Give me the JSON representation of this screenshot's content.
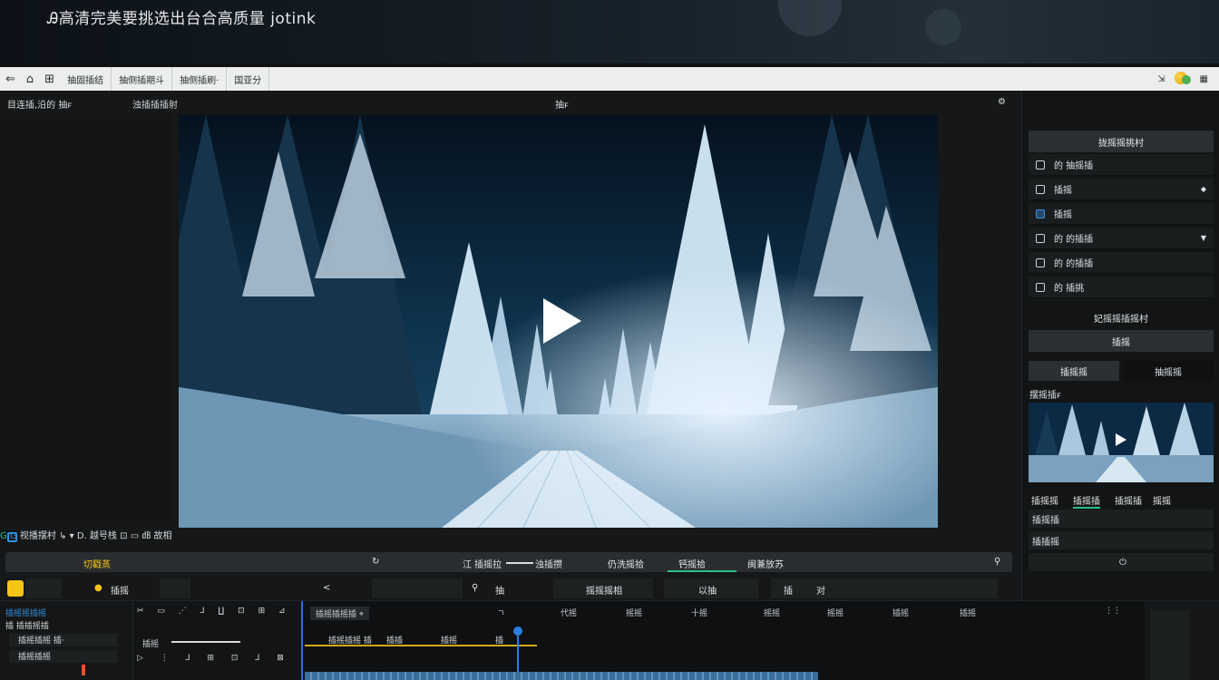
{
  "banner": {
    "title": "Ꭿ高清完美要挑选出台合高质量 jotink"
  },
  "menubar": {
    "back_icon": "back-arrow-icon",
    "items": [
      "⌂",
      "⊞",
      "抽固插结",
      "抽侧插期斗",
      "抽侧插刷·",
      "国亚分"
    ],
    "right_icon": "pin-icon"
  },
  "subhead": {
    "left": "目连插,沿的 抽ꜰ",
    "left2": "浊插插插射",
    "center": "抽ꜰ",
    "right": "⚙"
  },
  "viewer": {
    "play_label": "play-icon"
  },
  "vctrl": {
    "label1": "G",
    "label2": "G",
    "media_label": "视播摆村",
    "media_arrow": "↳",
    "caret": "▾",
    "time_label": "D. 越号栈",
    "right_label": "‍㏈ 故相"
  },
  "tabstrip": {
    "left_label": "切戳蒸",
    "icon1": "↻",
    "tab1": "江 插摇拉",
    "tab2": "浊插攒",
    "tab3": "仍洗摇拾",
    "tab4": "钙摇拾",
    "tab5": "闽兼放苏"
  },
  "toolrow": {
    "item1": "插摇",
    "arrow": "<",
    "icon": "⚲",
    "item2": "抽",
    "item3": "摇摇摇相",
    "item4": "以抽",
    "item5": "插",
    "item6": "对"
  },
  "rightpanel": {
    "head": "拢摇摇挑村",
    "items": [
      {
        "label": "的 抽摇插",
        "icon": "clip-icon",
        "chevron": false
      },
      {
        "label": "插摇",
        "icon": "image-icon",
        "chevron": true
      },
      {
        "label": "插摇",
        "icon": "color-icon",
        "chevron": false
      },
      {
        "label": "的 的插插",
        "icon": "layers-icon",
        "chevron": true
      },
      {
        "label": "的 的插插",
        "icon": "grid-icon",
        "chevron": false
      },
      {
        "label": "的 插挑",
        "icon": "export-icon",
        "chevron": false
      }
    ],
    "section_label": "妃摇摇插摇村",
    "button": "插摇",
    "seg1": "插摇摇",
    "seg2": "抽摇摇",
    "preview_label": "摆摇插ꜰ",
    "tabs": [
      "插摇摇",
      "插摇插",
      "插摇插",
      "摇摇"
    ],
    "field1": "插摇插",
    "field2": "插插摇",
    "power_icon": "⏻"
  },
  "timeline": {
    "left_items": [
      "插摇摇插摇",
      "插 插插摇插",
      "插摇插摇 插·",
      "插摇插摇",
      "摇插插"
    ],
    "tools_label": "插摇",
    "ruler": [
      "插摇插摇插 ⌖",
      "ㄱ",
      "代摇",
      "摇摇",
      "十摇",
      "摇摇",
      "摇摇",
      "插摇",
      "插摇",
      "⋮⋮"
    ],
    "track_labels": [
      "插摇插摇 插",
      "插插",
      "插摇",
      "插"
    ]
  }
}
